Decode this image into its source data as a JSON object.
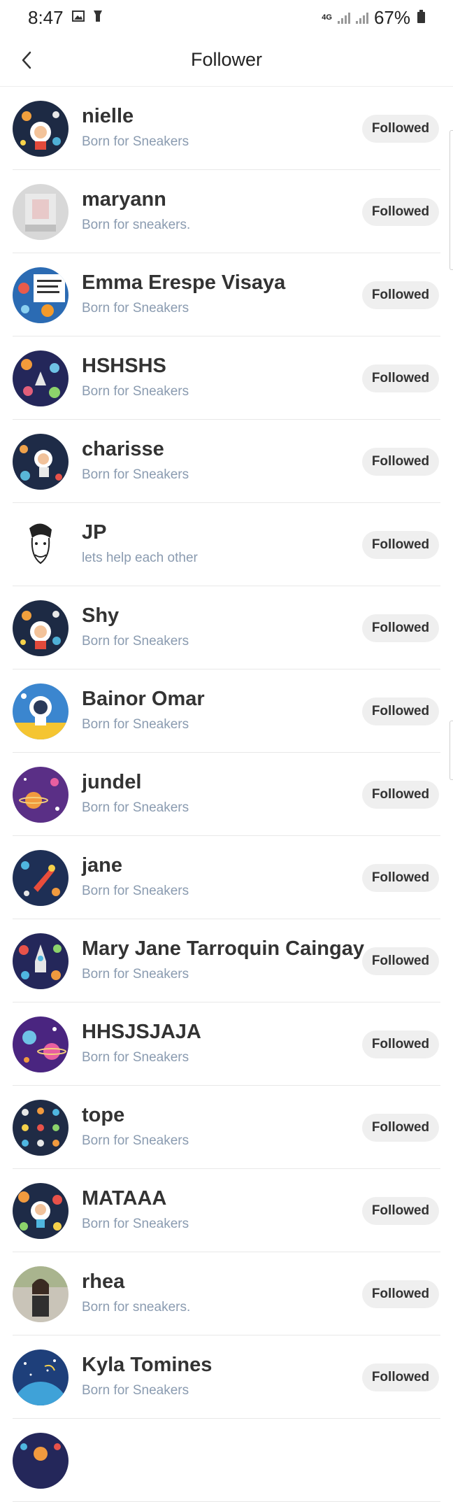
{
  "status_bar": {
    "time": "8:47",
    "icons": [
      "gallery-icon",
      "flashlight-icon"
    ],
    "network": "4G",
    "battery": "67%"
  },
  "header": {
    "back_icon": "chevron-left-icon",
    "title": "Follower"
  },
  "followers": [
    {
      "name": "nielle",
      "bio": "Born for Sneakers",
      "button": "Followed",
      "avatar": "space-boy-astronaut"
    },
    {
      "name": "maryann",
      "bio": "Born for sneakers.",
      "button": "Followed",
      "avatar": "photo-grey"
    },
    {
      "name": "Emma Erespe Visaya",
      "bio": "Born for Sneakers",
      "button": "Followed",
      "avatar": "space-poster"
    },
    {
      "name": "HSHSHS",
      "bio": "Born for Sneakers",
      "button": "Followed",
      "avatar": "space-rocket-planets"
    },
    {
      "name": "charisse",
      "bio": "Born for Sneakers",
      "button": "Followed",
      "avatar": "space-astronaut"
    },
    {
      "name": "JP",
      "bio": "lets help each other",
      "button": "Followed",
      "avatar": "sketch-face"
    },
    {
      "name": "Shy",
      "bio": "Born for Sneakers",
      "button": "Followed",
      "avatar": "space-boy-astronaut"
    },
    {
      "name": "Bainor Omar",
      "bio": "Born for Sneakers",
      "button": "Followed",
      "avatar": "astronaut-yellow"
    },
    {
      "name": "jundel",
      "bio": "Born for Sneakers",
      "button": "Followed",
      "avatar": "purple-planet"
    },
    {
      "name": "jane",
      "bio": "Born for Sneakers",
      "button": "Followed",
      "avatar": "space-rocket"
    },
    {
      "name": "Mary Jane Tarroquin Caingay",
      "bio": "Born for Sneakers",
      "button": "Followed",
      "avatar": "space-rocket-planets"
    },
    {
      "name": "HHSJSJAJA",
      "bio": "Born for Sneakers",
      "button": "Followed",
      "avatar": "purple-planets"
    },
    {
      "name": "tope",
      "bio": "Born for Sneakers",
      "button": "Followed",
      "avatar": "space-pattern"
    },
    {
      "name": "MATAAA",
      "bio": "Born for Sneakers",
      "button": "Followed",
      "avatar": "space-astronaut-planets"
    },
    {
      "name": "rhea",
      "bio": "Born for sneakers.",
      "button": "Followed",
      "avatar": "photo-girl"
    },
    {
      "name": "Kyla Tomines",
      "bio": "Born for Sneakers",
      "button": "Followed",
      "avatar": "blue-planet"
    }
  ],
  "colors": {
    "name": "#333333",
    "bio": "#8a9bb0",
    "button_bg": "#efefef",
    "divider": "#e8e8e8"
  }
}
